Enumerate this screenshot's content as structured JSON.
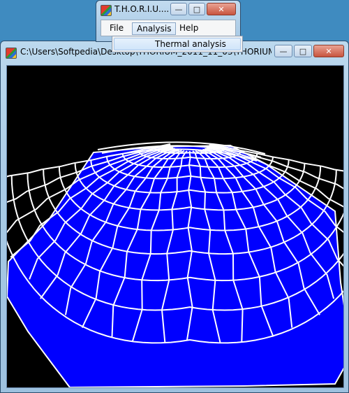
{
  "viewer_window": {
    "title": "C:\\Users\\Softpedia\\Desktop\\THORIUM_2011_11_03\\THORIUM_20...",
    "minimize_glyph": "—",
    "maximize_glyph": "□",
    "close_glyph": "✕"
  },
  "main_window": {
    "title": "T.H.O.R.I.U....",
    "minimize_glyph": "—",
    "maximize_glyph": "□",
    "close_glyph": "✕"
  },
  "menu": {
    "file": "File",
    "analysis": "Analysis",
    "help": "Help"
  },
  "analysis_menu": {
    "items": [
      "Thermal analysis"
    ]
  },
  "colors": {
    "mesh_fill": "#0000ff",
    "mesh_lines": "#ffffff",
    "viewport_bg": "#000000"
  },
  "icons": {
    "app_icon": "application-icon"
  }
}
